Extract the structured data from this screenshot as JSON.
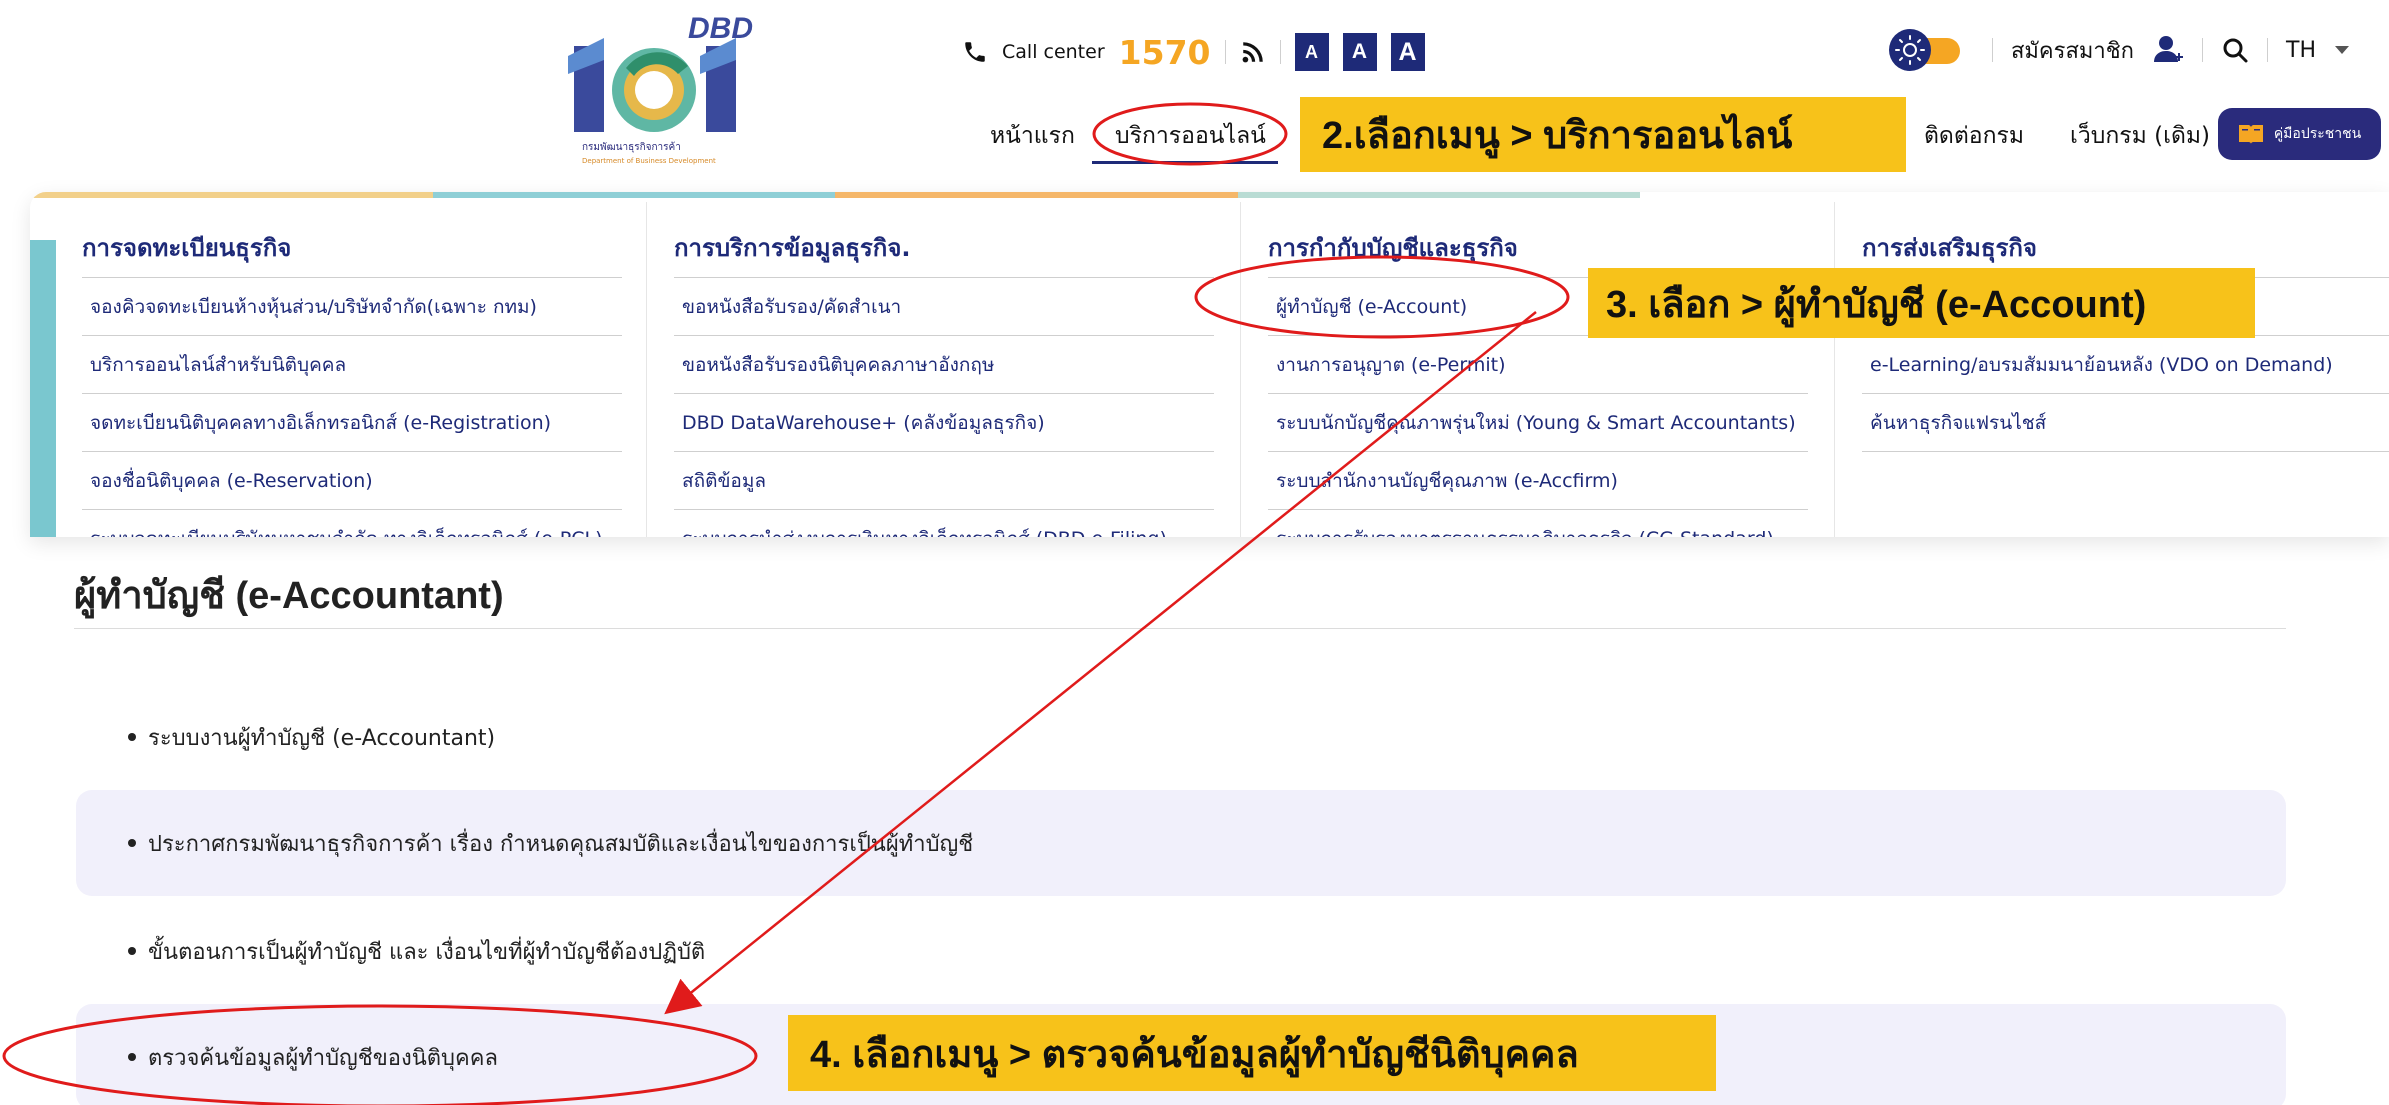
{
  "header": {
    "logo_text": "DBD",
    "logo_sub1": "กรมพัฒนาธุรกิจการค้า",
    "logo_sub2": "Department of Business Development",
    "call_center_label": "Call center",
    "call_center_number": "1570",
    "font_sizes": [
      "A",
      "A",
      "A"
    ],
    "signup_label": "สมัครสมาชิก",
    "language": "TH",
    "nav": {
      "home": "หน้าแรก",
      "online_services": "บริการออนไลน์",
      "contact": "ติดต่อกรม",
      "old_website": "เว็บกรม (เดิม)",
      "guide": "คู่มือประชาชน"
    }
  },
  "megamenu": {
    "columns": [
      {
        "heading": "การจดทะเบียนธุรกิจ",
        "items": [
          "จองคิวจดทะเบียนห้างหุ้นส่วน/บริษัทจำกัด(เฉพาะ กทม)",
          "บริการออนไลน์สำหรับนิติบุคคล",
          "จดทะเบียนนิติบุคคลทางอิเล็กทรอนิกส์ (e-Registration)",
          "จองชื่อนิติบุคคล (e-Reservation)",
          "ระบบจดทะเบียนบริษัทมหาชนจำกัด ทางอิเล็กทรอนิกส์ (e-PCL)"
        ]
      },
      {
        "heading": "การบริการข้อมูลธุรกิจ.",
        "items": [
          "ขอหนังสือรับรอง/คัดสำเนา",
          "ขอหนังสือรับรองนิติบุคคลภาษาอังกฤษ",
          "DBD DataWarehouse+ (คลังข้อมูลธุรกิจ)",
          "สถิติข้อมูล",
          "ระบบการนำส่งงบการเงินทางอิเล็กทรอนิกส์ (DBD e-Filing)"
        ]
      },
      {
        "heading": "การกำกับบัญชีและธุรกิจ",
        "items": [
          "ผู้ทำบัญชี (e-Account)",
          "งานการอนุญาต (e-Permit)",
          "ระบบนักบัญชีคุณภาพรุ่นใหม่ (Young & Smart Accountants)",
          "ระบบสำนักงานบัญชีคุณภาพ (e-Accfirm)",
          "ระบบการรับรองมาตรฐานธรรมาภิบาลธุรกิจ (CG Standard)"
        ]
      },
      {
        "heading": "การส่งเสริมธุรกิจ",
        "items": [
          "",
          "e-Learning/อบรมสัมมนาย้อนหลัง (VDO on Demand)",
          "ค้นหาธุรกิจแฟรนไชส์"
        ]
      }
    ]
  },
  "content": {
    "title": "ผู้ทำบัญชี (e-Accountant)",
    "items": [
      "ระบบงานผู้ทำบัญชี (e-Accountant)",
      "ประกาศกรมพัฒนาธุรกิจการค้า เรื่อง กำหนดคุณสมบัติและเงื่อนไขของการเป็นผู้ทำบัญชี",
      "ขั้นตอนการเป็นผู้ทำบัญชี และ เงื่อนไขที่ผู้ทำบัญชีต้องปฏิบัติ",
      "ตรวจค้นข้อมูลผู้ทำบัญชีของนิติบุคคล"
    ]
  },
  "annotations": {
    "step2": "2.เลือกเมนู > บริการออนไลน์",
    "step3": "3. เลือก > ผู้ทำบัญชี (e-Account)",
    "step4": "4. เลือกเมนู > ตรวจค้นข้อมูลผู้ทำบัญชีนิติบุคคล"
  },
  "colors": {
    "navy": "#1e2a78",
    "accent_orange": "#f5a623",
    "callout_yellow": "#f7c21a",
    "annotation_red": "#e01b1b",
    "row_shade": "#f1f0fb"
  }
}
